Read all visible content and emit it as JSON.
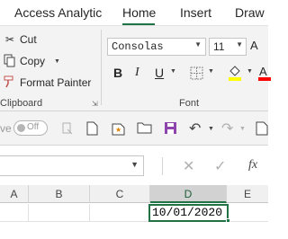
{
  "app": {
    "title": "Access Analytic"
  },
  "tabs": [
    {
      "label": "Home",
      "active": true
    },
    {
      "label": "Insert",
      "active": false
    },
    {
      "label": "Draw",
      "active": false
    }
  ],
  "clipboard": {
    "cut_label": "Cut",
    "copy_label": "Copy",
    "format_painter_label": "Format Painter",
    "group_label": "Clipboard"
  },
  "font": {
    "name": "Consolas",
    "size": "11",
    "group_label": "Font",
    "bold": "B",
    "italic": "I",
    "underline": "U"
  },
  "qat": {
    "autosave_partial": "ve",
    "toggle_text": "Off"
  },
  "formula_bar": {
    "fx": "fx"
  },
  "columns": [
    "A",
    "B",
    "C",
    "D",
    "E"
  ],
  "active_cell": {
    "column": "D",
    "value": "10/01/2020"
  },
  "colors": {
    "accent": "#217346",
    "ribbon": "#f3f3f3"
  }
}
